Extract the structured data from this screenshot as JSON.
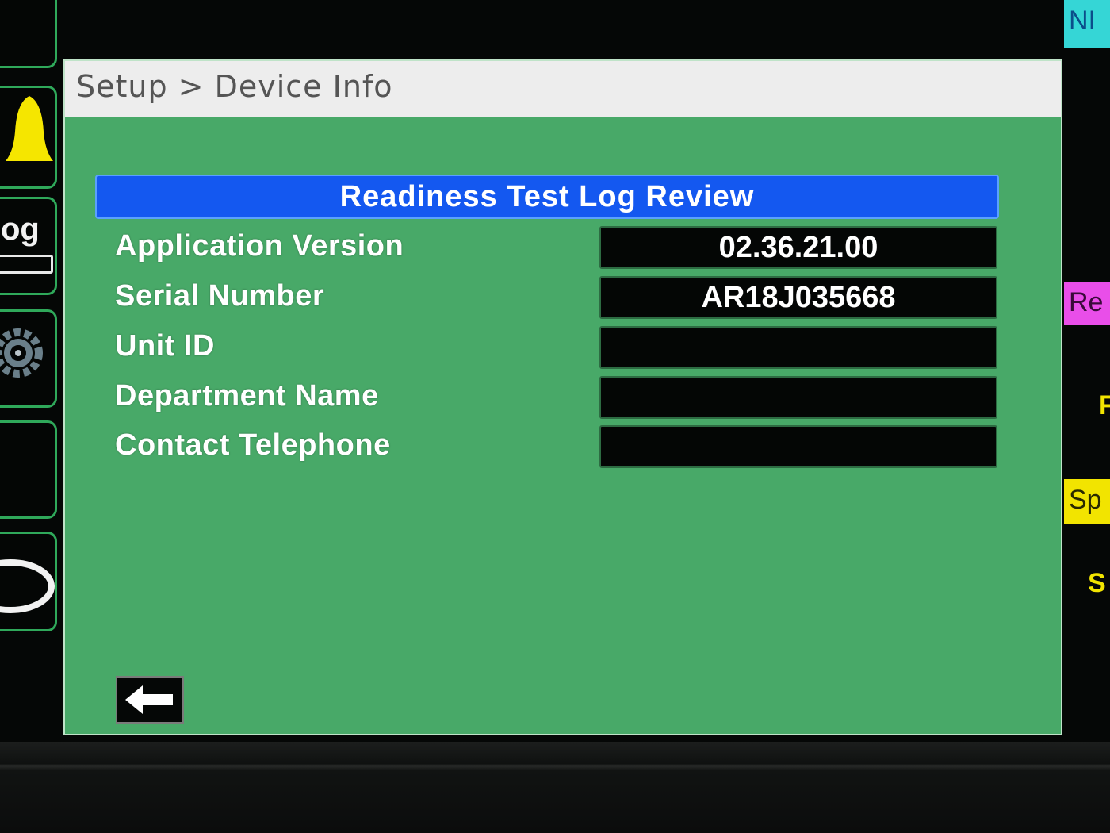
{
  "breadcrumb": "Setup > Device Info",
  "panel_title": "Readiness Test Log Review",
  "rows": [
    {
      "label": "Application Version",
      "value": "02.36.21.00"
    },
    {
      "label": "Serial Number",
      "value": "AR18J035668"
    },
    {
      "label": "Unit ID",
      "value": ""
    },
    {
      "label": "Department Name",
      "value": ""
    },
    {
      "label": "Contact Telephone",
      "value": ""
    }
  ],
  "left_sidebar": {
    "items": [
      {
        "icon": "bell-icon"
      },
      {
        "label": "og"
      },
      {
        "icon": "gear-icon"
      },
      {
        "icon": "blank"
      },
      {
        "icon": "oval-icon"
      }
    ]
  },
  "right_strip": {
    "items": [
      {
        "label": "NI",
        "color": "#35d6d6"
      },
      {
        "label": "Re",
        "color": "#e94ee9"
      },
      {
        "label": "F",
        "color": "#f2e400"
      },
      {
        "label": "Sp",
        "color": "#f2e400"
      },
      {
        "label": "S",
        "color": "#f2e400"
      }
    ]
  },
  "back_button": {
    "icon": "back-arrow-icon"
  },
  "colors": {
    "panel_bg": "#48a968",
    "title_bar": "#1458f0",
    "field_bg": "#040605",
    "breadcrumb_bar": "#ededed"
  }
}
